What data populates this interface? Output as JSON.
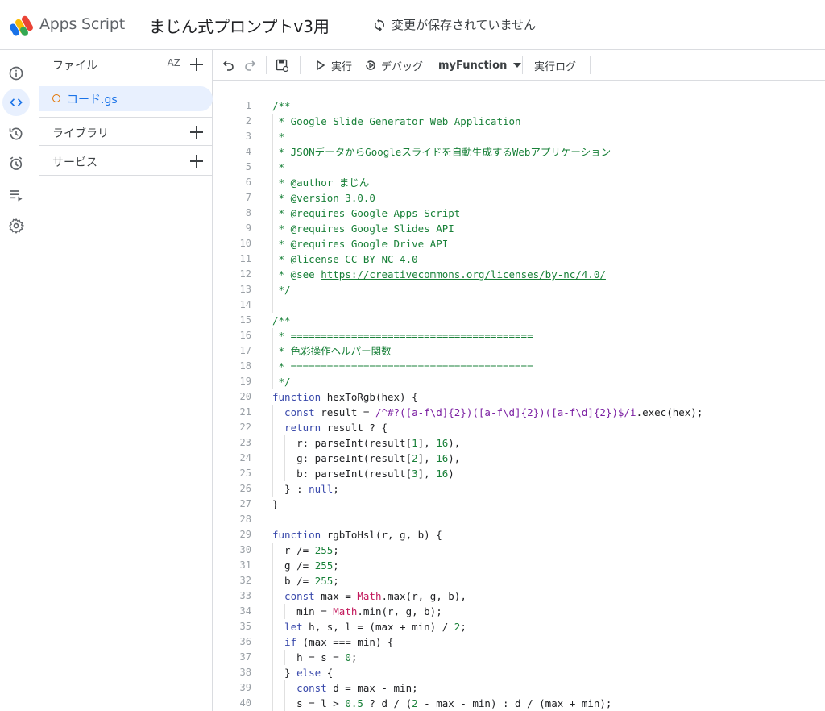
{
  "header": {
    "app_name": "Apps Script",
    "project_title": "まじん式プロンプトv3用",
    "save_status": "変更が保存されていません"
  },
  "rail": {
    "icons": [
      "info-icon",
      "code-icon",
      "history-icon",
      "alarm-icon",
      "executions-icon",
      "settings-icon"
    ]
  },
  "panel": {
    "files_label": "ファイル",
    "sort_label": "AZ",
    "file_name": "コード.gs",
    "libraries_label": "ライブラリ",
    "services_label": "サービス"
  },
  "toolbar": {
    "run_label": "実行",
    "debug_label": "デバッグ",
    "function_name": "myFunction",
    "log_label": "実行ログ"
  },
  "colors": {
    "accent": "#1a73e8",
    "selected_bg": "#e8f0fe",
    "comment": "#188038",
    "keyword": "#3949ab",
    "number": "#188038",
    "math": "#c2185b",
    "regex": "#7b1fa2"
  },
  "code": {
    "line_numbers": [
      "1",
      "2",
      "3",
      "4",
      "5",
      "6",
      "7",
      "8",
      "9",
      "10",
      "11",
      "12",
      "13",
      "14",
      "15",
      "16",
      "17",
      "18",
      "19",
      "20",
      "21",
      "22",
      "23",
      "24",
      "25",
      "26",
      "27",
      "28",
      "29",
      "30",
      "31",
      "32",
      "33",
      "34",
      "35",
      "36",
      "37",
      "38",
      "39",
      "40"
    ],
    "l1": "/**",
    "l2": " * Google Slide Generator Web Application",
    "l3": " *",
    "l4": " * JSONデータからGoogleスライドを自動生成するWebアプリケーション",
    "l5": " *",
    "l6": " * @author まじん",
    "l7": " * @version 3.0.0",
    "l8": " * @requires Google Apps Script",
    "l9": " * @requires Google Slides API",
    "l10": " * @requires Google Drive API",
    "l11": " * @license CC BY-NC 4.0",
    "l12a": " * @see ",
    "l12b": "https://creativecommons.org/licenses/by-nc/4.0/",
    "l13": " */",
    "l15": "/**",
    "l16": " * ========================================",
    "l17": " * 色彩操作ヘルパー関数",
    "l18": " * ========================================",
    "l19": " */",
    "l20a": "function",
    "l20b": " hexToRgb(hex) {",
    "l21a": "  const",
    "l21b": " result = ",
    "l21c": "/^#?([a-f\\d]{2})([a-f\\d]{2})([a-f\\d]{2})$/i",
    "l21d": ".exec(hex);",
    "l22a": "  return",
    "l22b": " result ? {",
    "l23a": "    r: parseInt(result[",
    "l23b": "1",
    "l23c": "], ",
    "l23d": "16",
    "l23e": "),",
    "l24a": "    g: parseInt(result[",
    "l24b": "2",
    "l24c": "], ",
    "l24d": "16",
    "l24e": "),",
    "l25a": "    b: parseInt(result[",
    "l25b": "3",
    "l25c": "], ",
    "l25d": "16",
    "l25e": ")",
    "l26a": "  } : ",
    "l26b": "null",
    "l26c": ";",
    "l27": "}",
    "l29a": "function",
    "l29b": " rgbToHsl(r, g, b) {",
    "l30a": "  r /= ",
    "l30b": "255",
    "l30c": ";",
    "l31a": "  g /= ",
    "l31b": "255",
    "l31c": ";",
    "l32a": "  b /= ",
    "l32b": "255",
    "l32c": ";",
    "l33a": "  const",
    "l33b": " max = ",
    "l33c": "Math",
    "l33d": ".max(r, g, b),",
    "l34a": "    min = ",
    "l34b": "Math",
    "l34c": ".min(r, g, b);",
    "l35a": "  let",
    "l35b": " h, s, l = (max + min) / ",
    "l35c": "2",
    "l35d": ";",
    "l36a": "  if",
    "l36b": " (max === min) {",
    "l37a": "    h = s = ",
    "l37b": "0",
    "l37c": ";",
    "l38a": "  } ",
    "l38b": "else",
    "l38c": " {",
    "l39a": "    const",
    "l39b": " d = max - min;",
    "l40a": "    s = l > ",
    "l40b": "0.5",
    "l40c": " ? d / (",
    "l40d": "2",
    "l40e": " - max - min) : d / (max + min);"
  }
}
